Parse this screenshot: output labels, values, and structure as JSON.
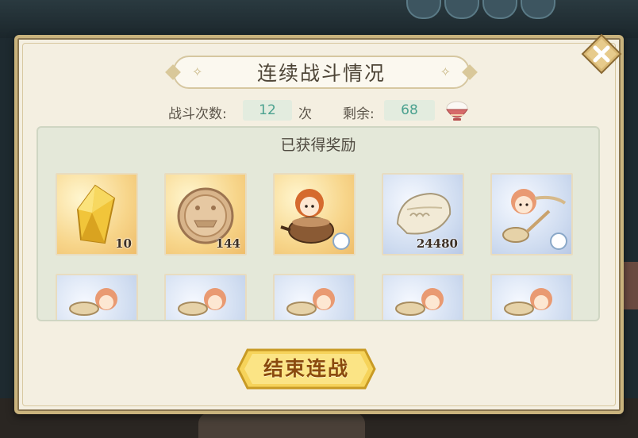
{
  "dialog": {
    "title": "连续战斗情况",
    "battle_count_label": "战斗次数:",
    "battle_count_value": "12",
    "battle_count_unit": "次",
    "remaining_label": "剩余:",
    "remaining_value": "68",
    "remaining_icon": "rice-bowl-icon"
  },
  "rewards": {
    "title": "已获得奖励",
    "items": [
      {
        "icon": "yellow-crystal-icon",
        "count": "10",
        "bg": "gold"
      },
      {
        "icon": "coin-icon",
        "count": "144",
        "bg": "gold"
      },
      {
        "icon": "food-soul-in-pot-icon",
        "count": "",
        "bg": "gold"
      },
      {
        "icon": "dumpling-icon",
        "count": "24480",
        "bg": "blue"
      },
      {
        "icon": "food-soul-with-spoon-icon",
        "count": "",
        "bg": "blue"
      }
    ]
  },
  "buttons": {
    "end_battle_label": "结束连战",
    "close_icon": "close-icon"
  },
  "colors": {
    "panel_bg": "#f4efe1",
    "stat_value": "#4aa18f",
    "button_gold": "#f6d35a"
  }
}
